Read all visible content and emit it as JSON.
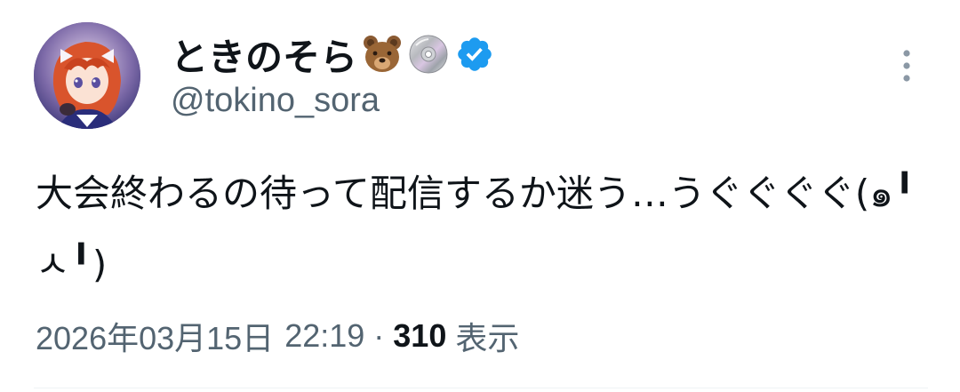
{
  "user": {
    "display_name": "ときのそら",
    "handle": "@tokino_sora",
    "emoji_icons": [
      "bear-face-icon",
      "dvd-disc-icon"
    ],
    "verified": true,
    "verified_color": "#1d9bf0"
  },
  "tweet": {
    "text": "大会終わるの待って配信するか迷う…うぐぐぐぐ(๑╹ㅅ╹)",
    "date": "2026年03月15日",
    "time": "22:19",
    "separator": "·",
    "views_count": "310",
    "views_label": "表示"
  },
  "colors": {
    "text_primary": "#0f1419",
    "text_secondary": "#536471",
    "divider": "#eff3f4"
  }
}
